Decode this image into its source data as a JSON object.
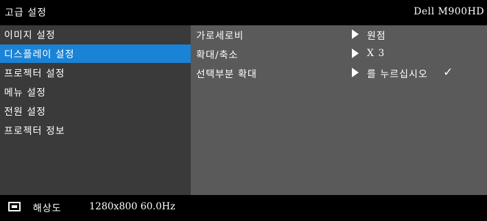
{
  "title": "고급 설정",
  "brand": "Dell  M900HD",
  "sidebar": {
    "items": [
      {
        "label": "이미지 설정",
        "active": false
      },
      {
        "label": "디스플레이 설정",
        "active": true
      },
      {
        "label": "프로젝터 설정",
        "active": false
      },
      {
        "label": "메뉴 설정",
        "active": false
      },
      {
        "label": "전원 설정",
        "active": false
      },
      {
        "label": "프로젝터 정보",
        "active": false
      }
    ]
  },
  "settings": [
    {
      "label": "가로세로비",
      "value": "원점"
    },
    {
      "label": "확대/축소",
      "value": "X 3"
    },
    {
      "label": "선택부분 확대",
      "value": "를 누르십시오",
      "check": "✓"
    }
  ],
  "status": {
    "icon": "monitor-icon",
    "label": "해상도",
    "value": "1280x800 60.0Hz"
  },
  "colors": {
    "background": "#000000",
    "sidebar": "#3a3a3a",
    "content": "#5a5a5a",
    "highlight": "#1b83d6",
    "text": "#ffffff"
  }
}
